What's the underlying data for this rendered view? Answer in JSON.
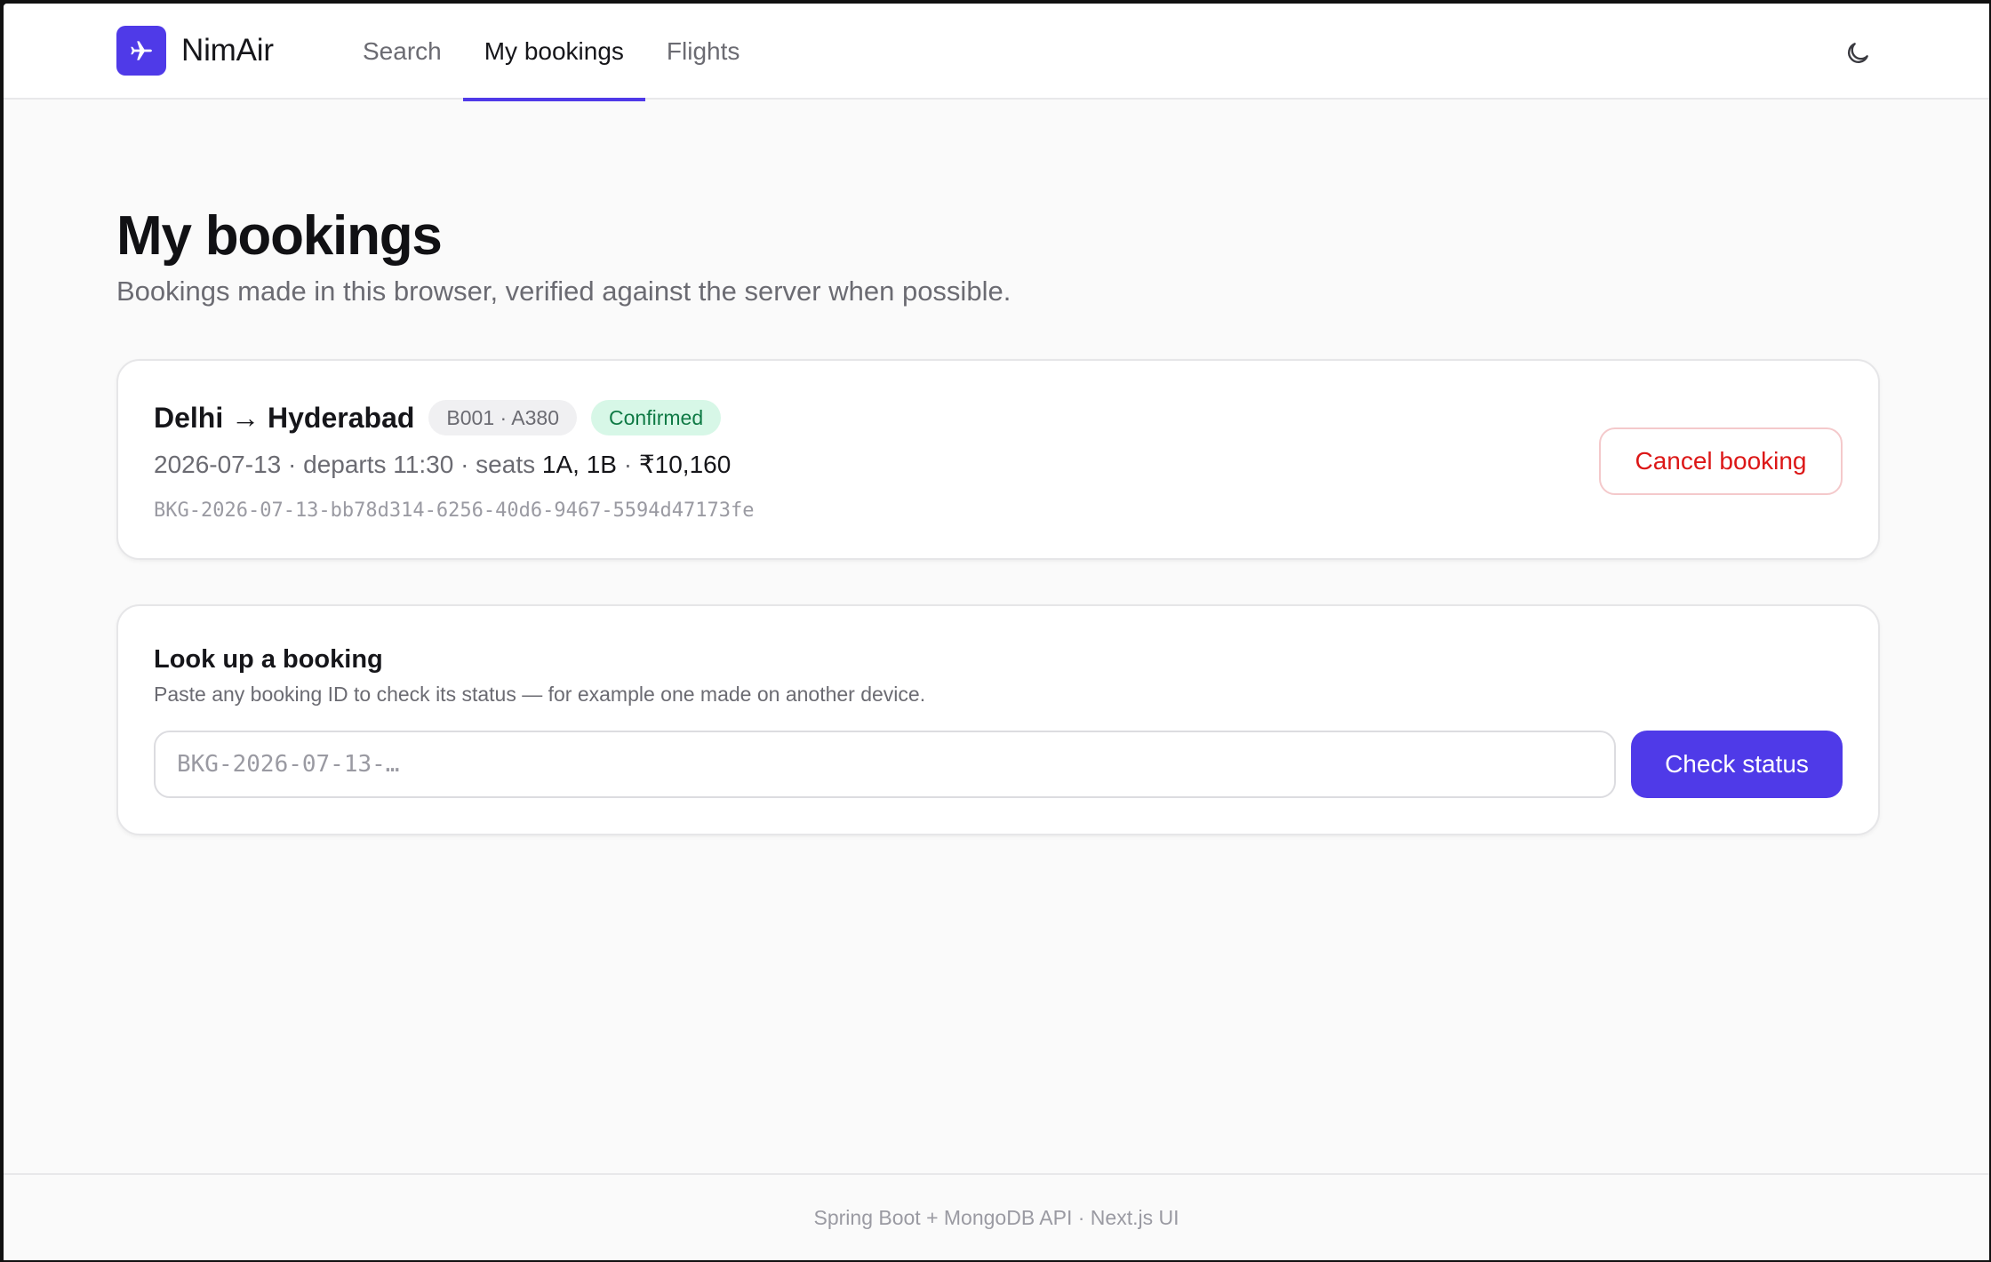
{
  "header": {
    "brand_name": "NimAir",
    "nav": [
      {
        "label": "Search",
        "active": false
      },
      {
        "label": "My bookings",
        "active": true
      },
      {
        "label": "Flights",
        "active": false
      }
    ],
    "icons": {
      "logo": "plane-icon",
      "theme": "moon-icon"
    }
  },
  "page": {
    "title": "My bookings",
    "subtitle": "Bookings made in this browser, verified against the server when possible."
  },
  "booking": {
    "route": "Delhi → Hyderabad",
    "flight_chip": "B001 · A380",
    "status": "Confirmed",
    "date": "2026-07-13",
    "sep1": " · departs ",
    "departs": "11:30",
    "sep2": " · seats ",
    "seats": "1A, 1B",
    "sep3": " · ",
    "price": "₹10,160",
    "id": "BKG-2026-07-13-bb78d314-6256-40d6-9467-5594d47173fe",
    "cancel_label": "Cancel booking"
  },
  "lookup": {
    "title": "Look up a booking",
    "help": "Paste any booking ID to check its status — for example one made on another device.",
    "input_value": "",
    "input_placeholder": "BKG-2026-07-13-…",
    "button_label": "Check status"
  },
  "footer": {
    "text": "Spring Boot + MongoDB API · Next.js UI"
  },
  "colors": {
    "accent": "#4f3ae8",
    "danger": "#dc1717",
    "success_bg": "#d7f7e7",
    "success_text": "#0f7a45"
  }
}
